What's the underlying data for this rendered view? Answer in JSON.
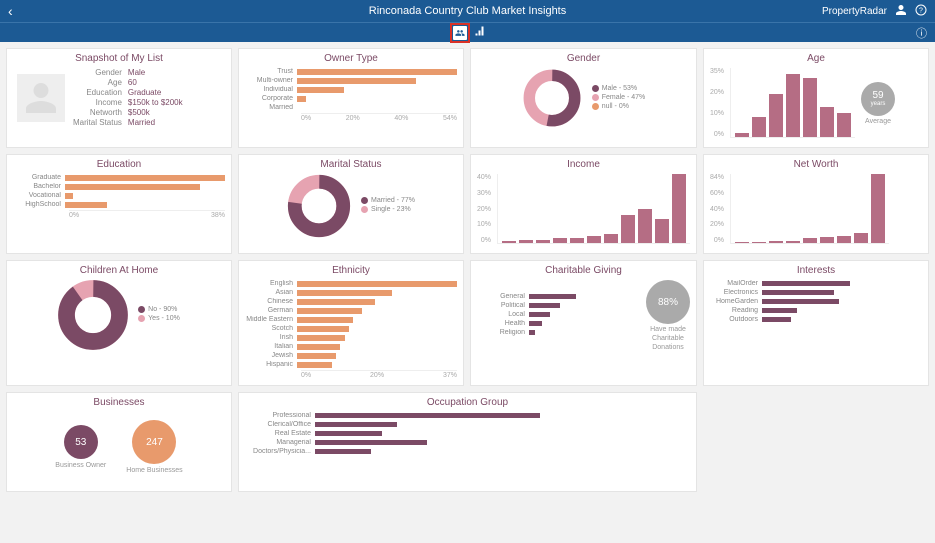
{
  "header": {
    "title": "Rinconada Country Club Market Insights",
    "brand": "PropertyRadar"
  },
  "snapshot": {
    "title": "Snapshot of My List",
    "fields": [
      {
        "k": "Gender",
        "v": "Male"
      },
      {
        "k": "Age",
        "v": "60"
      },
      {
        "k": "Education",
        "v": "Graduate"
      },
      {
        "k": "Income",
        "v": "$150k to $200k"
      },
      {
        "k": "Networth",
        "v": "$500k"
      },
      {
        "k": "Marital Status",
        "v": "Married"
      }
    ]
  },
  "ownerType": {
    "title": "Owner Type",
    "axis": [
      "0%",
      "20%",
      "40%",
      "54%"
    ]
  },
  "gender": {
    "title": "Gender",
    "legend": [
      {
        "label": "Male - 53%",
        "color": "#7b4a65"
      },
      {
        "label": "Female - 47%",
        "color": "#e6a3b1"
      },
      {
        "label": "null - 0%",
        "color": "#e89a6c"
      }
    ]
  },
  "age": {
    "title": "Age",
    "yaxis": [
      "35%",
      "20%",
      "10%",
      "0%"
    ],
    "avg_value": "59",
    "avg_unit": "years",
    "avg_label": "Average"
  },
  "education": {
    "title": "Education",
    "axis": [
      "0%",
      "38%"
    ]
  },
  "marital": {
    "title": "Marital Status",
    "legend": [
      {
        "label": "Married - 77%",
        "color": "#7b4a65"
      },
      {
        "label": "Single - 23%",
        "color": "#e6a3b1"
      }
    ]
  },
  "income": {
    "title": "Income",
    "yaxis": [
      "40%",
      "30%",
      "20%",
      "10%",
      "0%"
    ]
  },
  "networth": {
    "title": "Net Worth",
    "yaxis": [
      "84%",
      "60%",
      "40%",
      "20%",
      "0%"
    ]
  },
  "children": {
    "title": "Children At Home",
    "legend": [
      {
        "label": "No - 90%",
        "color": "#7b4a65"
      },
      {
        "label": "Yes - 10%",
        "color": "#e6a3b1"
      }
    ]
  },
  "ethnicity": {
    "title": "Ethnicity",
    "axis": [
      "0%",
      "20%",
      "37%"
    ]
  },
  "charity": {
    "title": "Charitable Giving",
    "pct": "88%",
    "caption1": "Have made",
    "caption2": "Charitable",
    "caption3": "Donations"
  },
  "interests": {
    "title": "Interests"
  },
  "businesses": {
    "title": "Businesses",
    "items": [
      {
        "value": "53",
        "label": "Business Owner",
        "color": "#7b4a65"
      },
      {
        "value": "247",
        "label": "Home Businesses",
        "color": "#e89a6c"
      }
    ]
  },
  "occupation": {
    "title": "Occupation Group"
  },
  "chart_data": [
    {
      "id": "ownerType",
      "type": "bar",
      "orientation": "horizontal",
      "xlabel": "",
      "ylabel": "",
      "xlim": [
        0,
        54
      ],
      "categories": [
        "Trust",
        "Multi-owner",
        "Individual",
        "Corporate",
        "Married"
      ],
      "values": [
        54,
        40,
        16,
        3,
        0
      ],
      "color": "#e89a6c"
    },
    {
      "id": "gender",
      "type": "pie",
      "series": [
        {
          "name": "Male",
          "value": 53,
          "color": "#7b4a65"
        },
        {
          "name": "Female",
          "value": 47,
          "color": "#e6a3b1"
        },
        {
          "name": "null",
          "value": 0,
          "color": "#e89a6c"
        }
      ]
    },
    {
      "id": "age",
      "type": "bar",
      "ylabel": "%",
      "ylim": [
        0,
        35
      ],
      "categories": [
        "b1",
        "b2",
        "b3",
        "b4",
        "b5",
        "b6",
        "b7"
      ],
      "values": [
        2,
        10,
        22,
        32,
        30,
        15,
        12
      ],
      "color": "#b56d84",
      "annotation": {
        "average": 59,
        "unit": "years"
      }
    },
    {
      "id": "education",
      "type": "bar",
      "orientation": "horizontal",
      "xlim": [
        0,
        38
      ],
      "categories": [
        "Graduate",
        "Bachelor",
        "Vocational",
        "HighSchool"
      ],
      "values": [
        38,
        32,
        2,
        10
      ],
      "color": "#e89a6c"
    },
    {
      "id": "marital",
      "type": "pie",
      "series": [
        {
          "name": "Married",
          "value": 77,
          "color": "#7b4a65"
        },
        {
          "name": "Single",
          "value": 23,
          "color": "#e6a3b1"
        }
      ]
    },
    {
      "id": "income",
      "type": "bar",
      "ylim": [
        0,
        40
      ],
      "categories": [
        "i1",
        "i2",
        "i3",
        "i4",
        "i5",
        "i6",
        "i7",
        "i8",
        "i9",
        "i10",
        "i11"
      ],
      "values": [
        1,
        2,
        2,
        3,
        3,
        4,
        5,
        16,
        20,
        14,
        40
      ],
      "color": "#b56d84"
    },
    {
      "id": "networth",
      "type": "bar",
      "ylim": [
        0,
        84
      ],
      "categories": [
        "n1",
        "n2",
        "n3",
        "n4",
        "n5",
        "n6",
        "n7",
        "n8",
        "n9"
      ],
      "values": [
        1,
        1,
        2,
        2,
        6,
        7,
        8,
        12,
        84
      ],
      "color": "#b56d84"
    },
    {
      "id": "children",
      "type": "pie",
      "series": [
        {
          "name": "No",
          "value": 90,
          "color": "#7b4a65"
        },
        {
          "name": "Yes",
          "value": 10,
          "color": "#e6a3b1"
        }
      ]
    },
    {
      "id": "ethnicity",
      "type": "bar",
      "orientation": "horizontal",
      "xlim": [
        0,
        37
      ],
      "categories": [
        "English",
        "Asian",
        "Chinese",
        "German",
        "Middle Eastern",
        "Scotch",
        "Irish",
        "Italian",
        "Jewish",
        "Hispanic"
      ],
      "values": [
        37,
        22,
        18,
        15,
        13,
        12,
        11,
        10,
        9,
        8
      ],
      "color": "#e89a6c"
    },
    {
      "id": "charity",
      "type": "bar",
      "orientation": "horizontal",
      "xlim": [
        0,
        100
      ],
      "categories": [
        "General",
        "Political",
        "Local",
        "Health",
        "Religion"
      ],
      "values": [
        45,
        30,
        20,
        12,
        6
      ],
      "color": "#7b4a65",
      "annotation": {
        "pct": 88
      }
    },
    {
      "id": "interests",
      "type": "bar",
      "orientation": "horizontal",
      "xlim": [
        0,
        100
      ],
      "categories": [
        "MailOrder",
        "Electronics",
        "HomeGarden",
        "Reading",
        "Outdoors"
      ],
      "values": [
        55,
        45,
        48,
        22,
        18
      ],
      "color": "#7b4a65"
    },
    {
      "id": "occupation",
      "type": "bar",
      "orientation": "horizontal",
      "xlim": [
        0,
        100
      ],
      "categories": [
        "Professional",
        "Clerical/Office",
        "Real Estate",
        "Managerial",
        "Doctors/Physicia..."
      ],
      "values": [
        60,
        22,
        18,
        30,
        15
      ],
      "color": "#7b4a65"
    }
  ]
}
